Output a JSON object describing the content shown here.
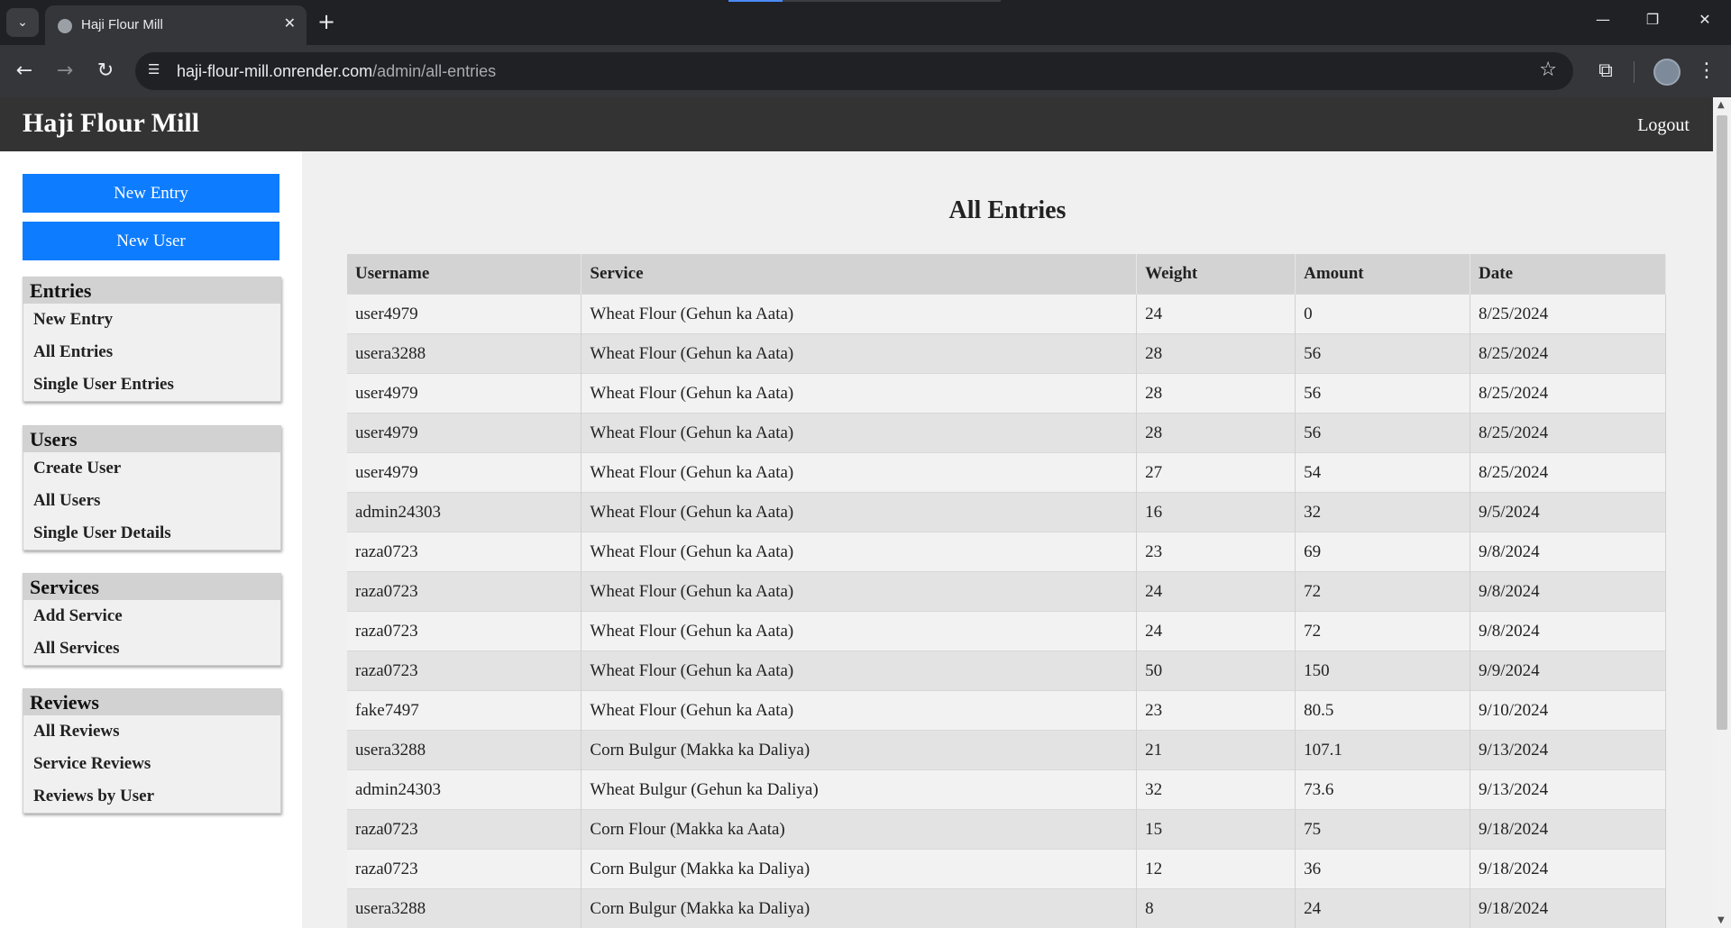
{
  "browser": {
    "tab_title": "Haji Flour Mill",
    "url_host": "haji-flour-mill.onrender.com",
    "url_path": "/admin/all-entries"
  },
  "header": {
    "brand": "Haji Flour Mill",
    "logout": "Logout"
  },
  "sidebar": {
    "buttons": [
      "New Entry",
      "New User"
    ],
    "sections": [
      {
        "title": "Entries",
        "items": [
          "New Entry",
          "All Entries",
          "Single User Entries"
        ]
      },
      {
        "title": "Users",
        "items": [
          "Create User",
          "All Users",
          "Single User Details"
        ]
      },
      {
        "title": "Services",
        "items": [
          "Add Service",
          "All Services"
        ]
      },
      {
        "title": "Reviews",
        "items": [
          "All Reviews",
          "Service Reviews",
          "Reviews by User"
        ]
      }
    ]
  },
  "main": {
    "heading": "All Entries",
    "columns": [
      "Username",
      "Service",
      "Weight",
      "Amount",
      "Date"
    ],
    "rows": [
      [
        "user4979",
        "Wheat Flour (Gehun ka Aata)",
        "24",
        "0",
        "8/25/2024"
      ],
      [
        "usera3288",
        "Wheat Flour (Gehun ka Aata)",
        "28",
        "56",
        "8/25/2024"
      ],
      [
        "user4979",
        "Wheat Flour (Gehun ka Aata)",
        "28",
        "56",
        "8/25/2024"
      ],
      [
        "user4979",
        "Wheat Flour (Gehun ka Aata)",
        "28",
        "56",
        "8/25/2024"
      ],
      [
        "user4979",
        "Wheat Flour (Gehun ka Aata)",
        "27",
        "54",
        "8/25/2024"
      ],
      [
        "admin24303",
        "Wheat Flour (Gehun ka Aata)",
        "16",
        "32",
        "9/5/2024"
      ],
      [
        "raza0723",
        "Wheat Flour (Gehun ka Aata)",
        "23",
        "69",
        "9/8/2024"
      ],
      [
        "raza0723",
        "Wheat Flour (Gehun ka Aata)",
        "24",
        "72",
        "9/8/2024"
      ],
      [
        "raza0723",
        "Wheat Flour (Gehun ka Aata)",
        "24",
        "72",
        "9/8/2024"
      ],
      [
        "raza0723",
        "Wheat Flour (Gehun ka Aata)",
        "50",
        "150",
        "9/9/2024"
      ],
      [
        "fake7497",
        "Wheat Flour (Gehun ka Aata)",
        "23",
        "80.5",
        "9/10/2024"
      ],
      [
        "usera3288",
        "Corn Bulgur (Makka ka Daliya)",
        "21",
        "107.1",
        "9/13/2024"
      ],
      [
        "admin24303",
        "Wheat Bulgur (Gehun ka Daliya)",
        "32",
        "73.6",
        "9/13/2024"
      ],
      [
        "raza0723",
        "Corn Flour (Makka ka Aata)",
        "15",
        "75",
        "9/18/2024"
      ],
      [
        "raza0723",
        "Corn Bulgur (Makka ka Daliya)",
        "12",
        "36",
        "9/18/2024"
      ],
      [
        "usera3288",
        "Corn Bulgur (Makka ka Daliya)",
        "8",
        "24",
        "9/18/2024"
      ]
    ]
  },
  "colors": {
    "primary_button": "#0d7cff",
    "header_bg": "#333333"
  }
}
